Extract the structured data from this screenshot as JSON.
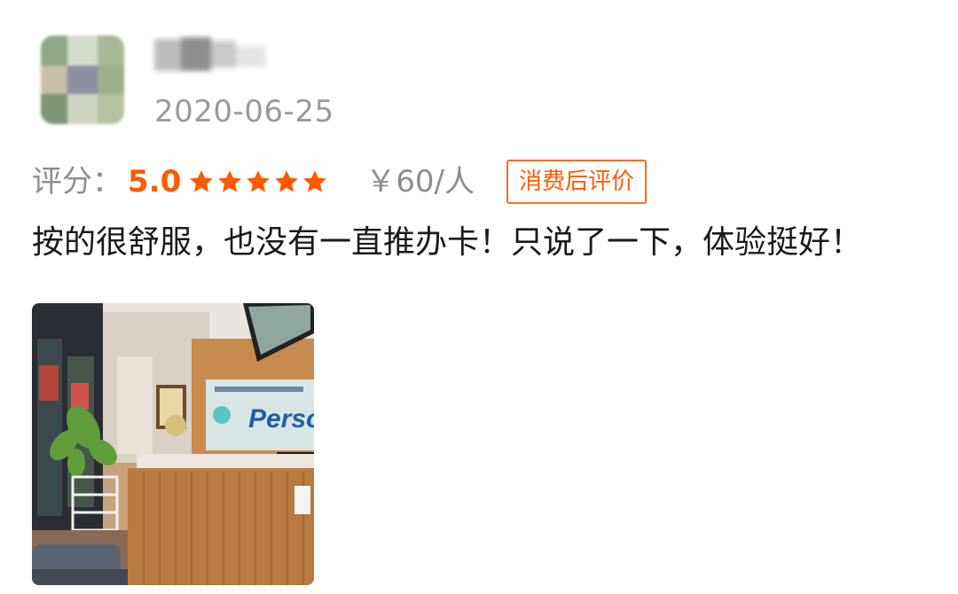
{
  "review": {
    "date": "2020-06-25",
    "rating_label": "评分：",
    "rating_score": "5.0",
    "star_count": 5,
    "price": "￥60/人",
    "badge": "消费后评价",
    "text": "按的很舒服，也没有一直推办卡！只说了一下，体验挺好！"
  },
  "photo": {
    "sign_text": "Perso"
  },
  "colors": {
    "accent": "#ff5a00",
    "muted_text": "#8e8e8e",
    "body_text": "#1a1a1a"
  }
}
